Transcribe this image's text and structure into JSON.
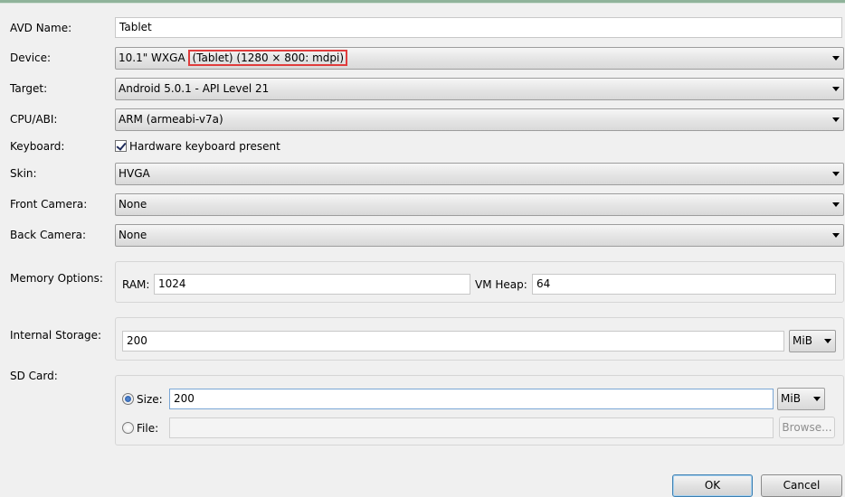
{
  "form": {
    "avd_name": {
      "label": "AVD Name:",
      "value": "Tablet"
    },
    "device": {
      "label": "Device:",
      "value_prefix": "10.1\" WXGA",
      "value_highlight": "(Tablet) (1280 × 800: mdpi)"
    },
    "target": {
      "label": "Target:",
      "value": "Android 5.0.1 - API Level 21"
    },
    "cpu_abi": {
      "label": "CPU/ABI:",
      "value": "ARM (armeabi-v7a)"
    },
    "keyboard": {
      "label": "Keyboard:",
      "checkbox_label": "Hardware keyboard present",
      "checked": true
    },
    "skin": {
      "label": "Skin:",
      "value": "HVGA"
    },
    "front_camera": {
      "label": "Front Camera:",
      "value": "None"
    },
    "back_camera": {
      "label": "Back Camera:",
      "value": "None"
    },
    "memory": {
      "label": "Memory Options:",
      "ram_label": "RAM:",
      "ram_value": "1024",
      "vm_heap_label": "VM Heap:",
      "vm_heap_value": "64"
    },
    "internal_storage": {
      "label": "Internal Storage:",
      "value": "200",
      "unit": "MiB"
    },
    "sd_card": {
      "label": "SD Card:",
      "size_label": "Size:",
      "size_value": "200",
      "size_unit": "MiB",
      "size_selected": true,
      "file_label": "File:",
      "file_value": "",
      "browse_label": "Browse..."
    }
  },
  "buttons": {
    "ok": "OK",
    "cancel": "Cancel"
  },
  "colors": {
    "highlight": "#e03c3c",
    "focus_border": "#3c7fb1"
  }
}
